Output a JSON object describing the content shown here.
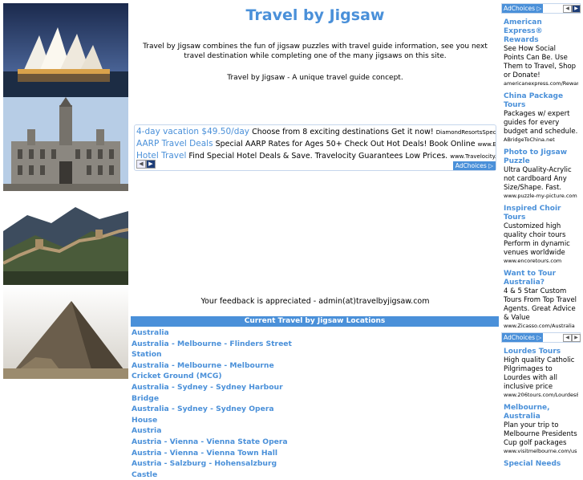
{
  "site": {
    "title": "Travel by Jigsaw",
    "intro": "Travel by Jigsaw combines the fun of jigsaw puzzles with travel guide information, see you next travel destination while completing one of the many jigsaws on this site.",
    "tagline": "Travel by Jigsaw - A unique travel guide concept.",
    "feedback": "Your feedback is appreciated - admin(at)travelbyjigsaw.com"
  },
  "photos": [
    {
      "icon": "sydney-opera-house-photo"
    },
    {
      "icon": "vienna-town-hall-photo"
    },
    {
      "icon": "great-wall-photo"
    },
    {
      "icon": "pyramid-photo"
    }
  ],
  "center_ads": {
    "adchoices": "AdChoices",
    "items": [
      {
        "headline": "4-day vacation $49.50/day",
        "text": "Choose from 8 exciting destinations Get it now!",
        "url": "DiamondResortsSpecials.com"
      },
      {
        "headline": "AARP Travel Deals",
        "text": "Special AARP Rates for Ages 50+ Check Out Hot Deals! Book Online",
        "url": "www.Expedia-AAR..."
      },
      {
        "headline": "Hotel Travel",
        "text": "Find Special Hotel Deals & Save. Travelocity Guarantees Low Prices.",
        "url": "www.Travelocity.com/Hotels"
      }
    ]
  },
  "locations": {
    "header": "Current Travel by Jigsaw Locations",
    "items": [
      "Australia",
      "Australia - Melbourne - Flinders Street Station",
      "Australia - Melbourne - Melbourne Cricket Ground (MCG)",
      "Australia - Sydney - Sydney Harbour Bridge",
      "Australia - Sydney - Sydney Opera House",
      "Austria",
      "Austria - Vienna - Vienna State Opera",
      "Austria - Vienna - Vienna Town Hall",
      "Austria - Salzburg - Hohensalzburg Castle"
    ]
  },
  "right_ads": {
    "adchoices": "AdChoices",
    "block1": [
      {
        "headline": "American Express® Rewards",
        "body": "See How Social Points Can Be. Use Them to Travel, Shop or Donate!",
        "url": "americanexpress.com/Rewar..."
      },
      {
        "headline": "China Package Tours",
        "body": "Packages w/ expert guides for every budget and schedule.",
        "url": "ABridgeToChina.net"
      },
      {
        "headline": "Photo to Jigsaw Puzzle",
        "body": "Ultra Quality-Acrylic not cardboard Any Size/Shape. Fast.",
        "url": "www.puzzle-my-picture.com"
      },
      {
        "headline": "Inspired Choir Tours",
        "body": "Customized high quality choir tours Perform in dynamic venues worldwide",
        "url": "www.encoretours.com"
      },
      {
        "headline": "Want to Tour Australia?",
        "body": "4 & 5 Star Custom Tours From Top Travel Agents. Great Advice & Value",
        "url": "www.Zicasso.com/Australia"
      }
    ],
    "block2": [
      {
        "headline": "Lourdes Tours",
        "body": "High quality Catholic Pilgrimages to Lourdes with all inclusive price",
        "url": "www.206tours.com/Lourdes&..."
      },
      {
        "headline": "Melbourne, Australia",
        "body": "Plan your trip to Melbourne Presidents Cup golf packages",
        "url": "www.visitmelbourne.com/us"
      },
      {
        "headline": "Special Needs",
        "body": "",
        "url": ""
      }
    ]
  },
  "colors": {
    "accent": "#4a90d9"
  }
}
